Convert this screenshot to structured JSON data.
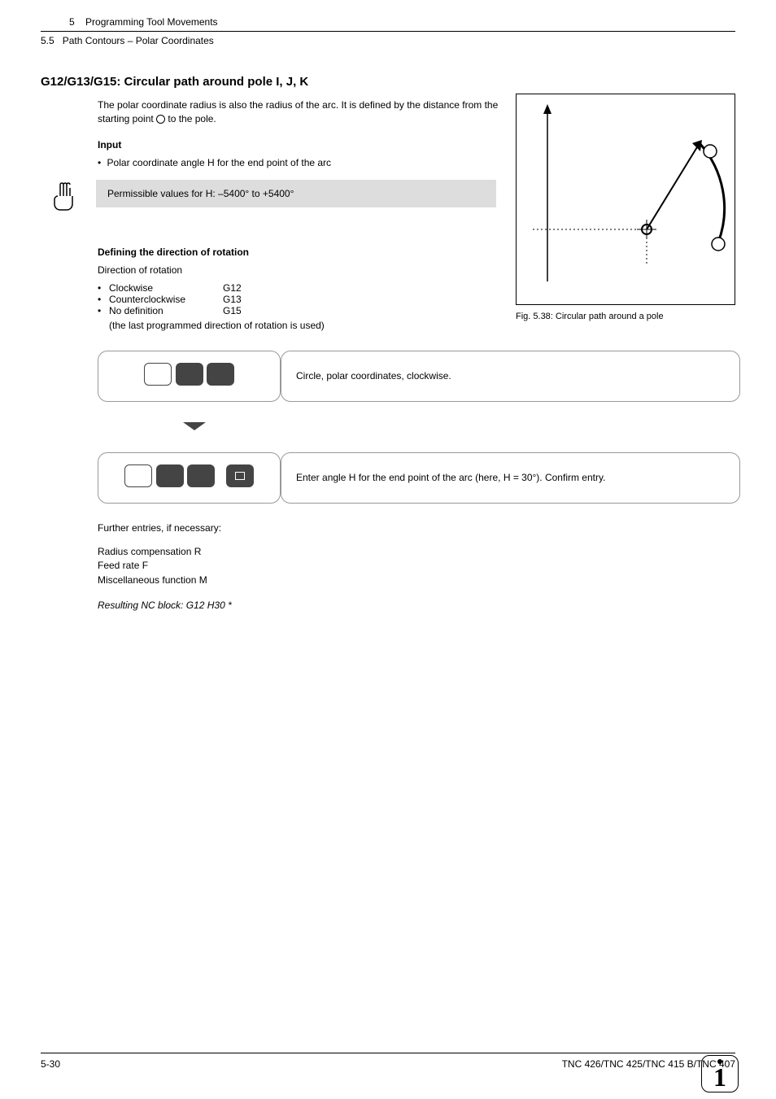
{
  "header": {
    "chapter_num": "5",
    "chapter_title": "Programming Tool Movements",
    "section_num": "5.5",
    "section_title": "Path Contours – Polar Coordinates"
  },
  "heading": "G12/G13/G15: Circular path around pole I, J, K",
  "intro": {
    "text_a": "The polar coordinate radius is also the radius of the arc. It is defined by the distance from the starting point ",
    "text_b": " to the pole.",
    "input_label": "Input",
    "input_bullet": "Polar coordinate angle H for the end point of the arc"
  },
  "note": "Permissible values for H: –5400° to +5400°",
  "figure_caption": "Fig. 5.38:  Circular path around a pole",
  "rotation": {
    "heading": "Defining the direction of rotation",
    "label": "Direction of rotation",
    "rows": [
      {
        "name": "Clockwise",
        "code": "G12"
      },
      {
        "name": "Counterclockwise",
        "code": "G13"
      },
      {
        "name": "No definition",
        "code": "G15"
      }
    ],
    "note": "(the last programmed direction of rotation is used)"
  },
  "steps": [
    {
      "desc": "Circle, polar coordinates, clockwise."
    },
    {
      "desc": "Enter angle H for the end point of the arc (here, H = 30°). Confirm entry."
    }
  ],
  "further": {
    "intro": "Further entries, if necessary:",
    "lines": [
      "Radius compensation R",
      "Feed rate F",
      "Miscellaneous function M"
    ],
    "result": "Resulting NC block: G12 H30 *"
  },
  "footer": {
    "page": "5-30",
    "doc": "TNC 426/TNC 425/TNC 415 B/TNC 407"
  }
}
